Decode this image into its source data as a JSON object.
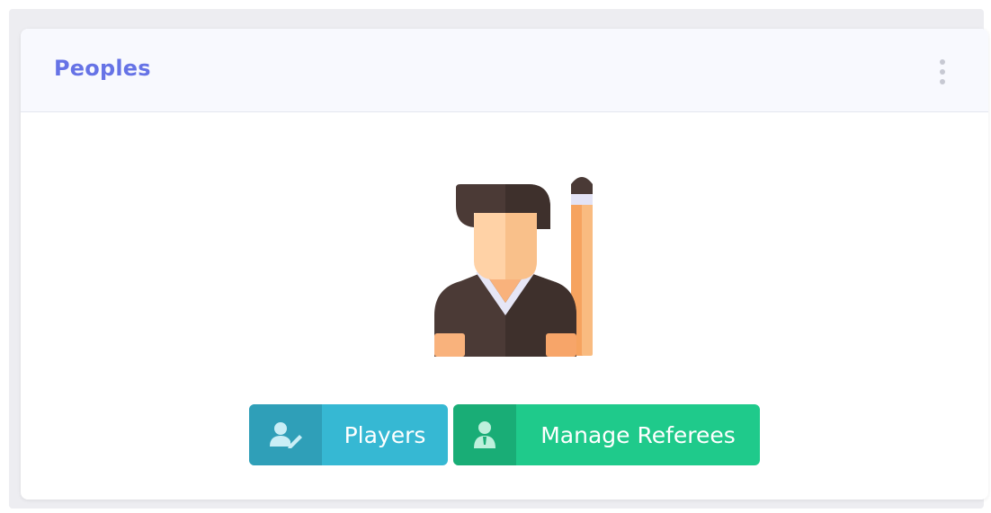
{
  "card": {
    "title": "Peoples",
    "menu_icon": "kebab-menu-icon"
  },
  "illustration": {
    "icon": "player-with-cue-icon"
  },
  "buttons": {
    "players": {
      "label": "Players",
      "icon": "user-edit-icon",
      "color": "#36b8d3"
    },
    "referees": {
      "label": "Manage Referees",
      "icon": "referee-user-icon",
      "color": "#1fca8b"
    }
  }
}
